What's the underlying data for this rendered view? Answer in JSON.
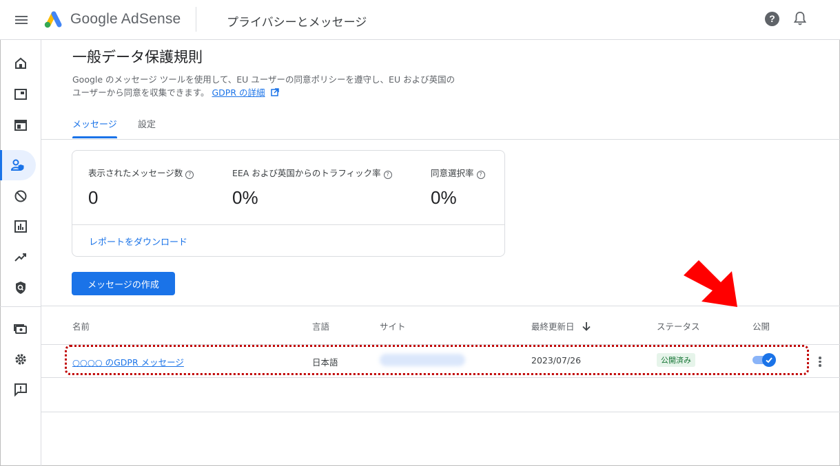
{
  "header": {
    "brand": "Google AdSense",
    "page_heading": "プライバシーとメッセージ",
    "help_glyph": "?"
  },
  "main": {
    "title": "一般データ保護規則",
    "description_line1": "Google のメッセージ ツールを使用して、EU ユーザーの同意ポリシーを遵守し、EU および英国の",
    "description_line2": "ユーザーから同意を収集できます。",
    "details_link": "GDPR の詳細",
    "tabs": [
      {
        "label": "メッセージ",
        "active": true
      },
      {
        "label": "設定",
        "active": false
      }
    ]
  },
  "stats": {
    "items": [
      {
        "label": "表示されたメッセージ数",
        "value": "0"
      },
      {
        "label": "EEA および英国からのトラフィック率",
        "value": "0%"
      },
      {
        "label": "同意選択率",
        "value": "0%"
      }
    ],
    "download_link": "レポートをダウンロード"
  },
  "create_button": "メッセージの作成",
  "table": {
    "columns": [
      "名前",
      "言語",
      "サイト",
      "最終更新日",
      "ステータス",
      "公開"
    ],
    "rows": [
      {
        "name": "○○○○ のGDPR メッセージ",
        "language": "日本語",
        "site": "",
        "updated": "2023/07/26",
        "status": "公開済み",
        "published": true
      }
    ]
  },
  "colors": {
    "accent": "#1a73e8",
    "status_bg": "#e6f4ea",
    "status_text": "#137333",
    "highlight": "#c00000"
  },
  "icons": {
    "header": [
      "menu-icon",
      "adsense-logo",
      "help-icon",
      "bell-icon"
    ],
    "rail": [
      "home-icon",
      "ads-icon",
      "sites-icon",
      "privacy-messaging-icon",
      "blocking-controls-icon",
      "reports-icon",
      "optimization-icon",
      "policy-center-icon",
      "payments-icon",
      "settings-icon",
      "feedback-icon"
    ]
  }
}
